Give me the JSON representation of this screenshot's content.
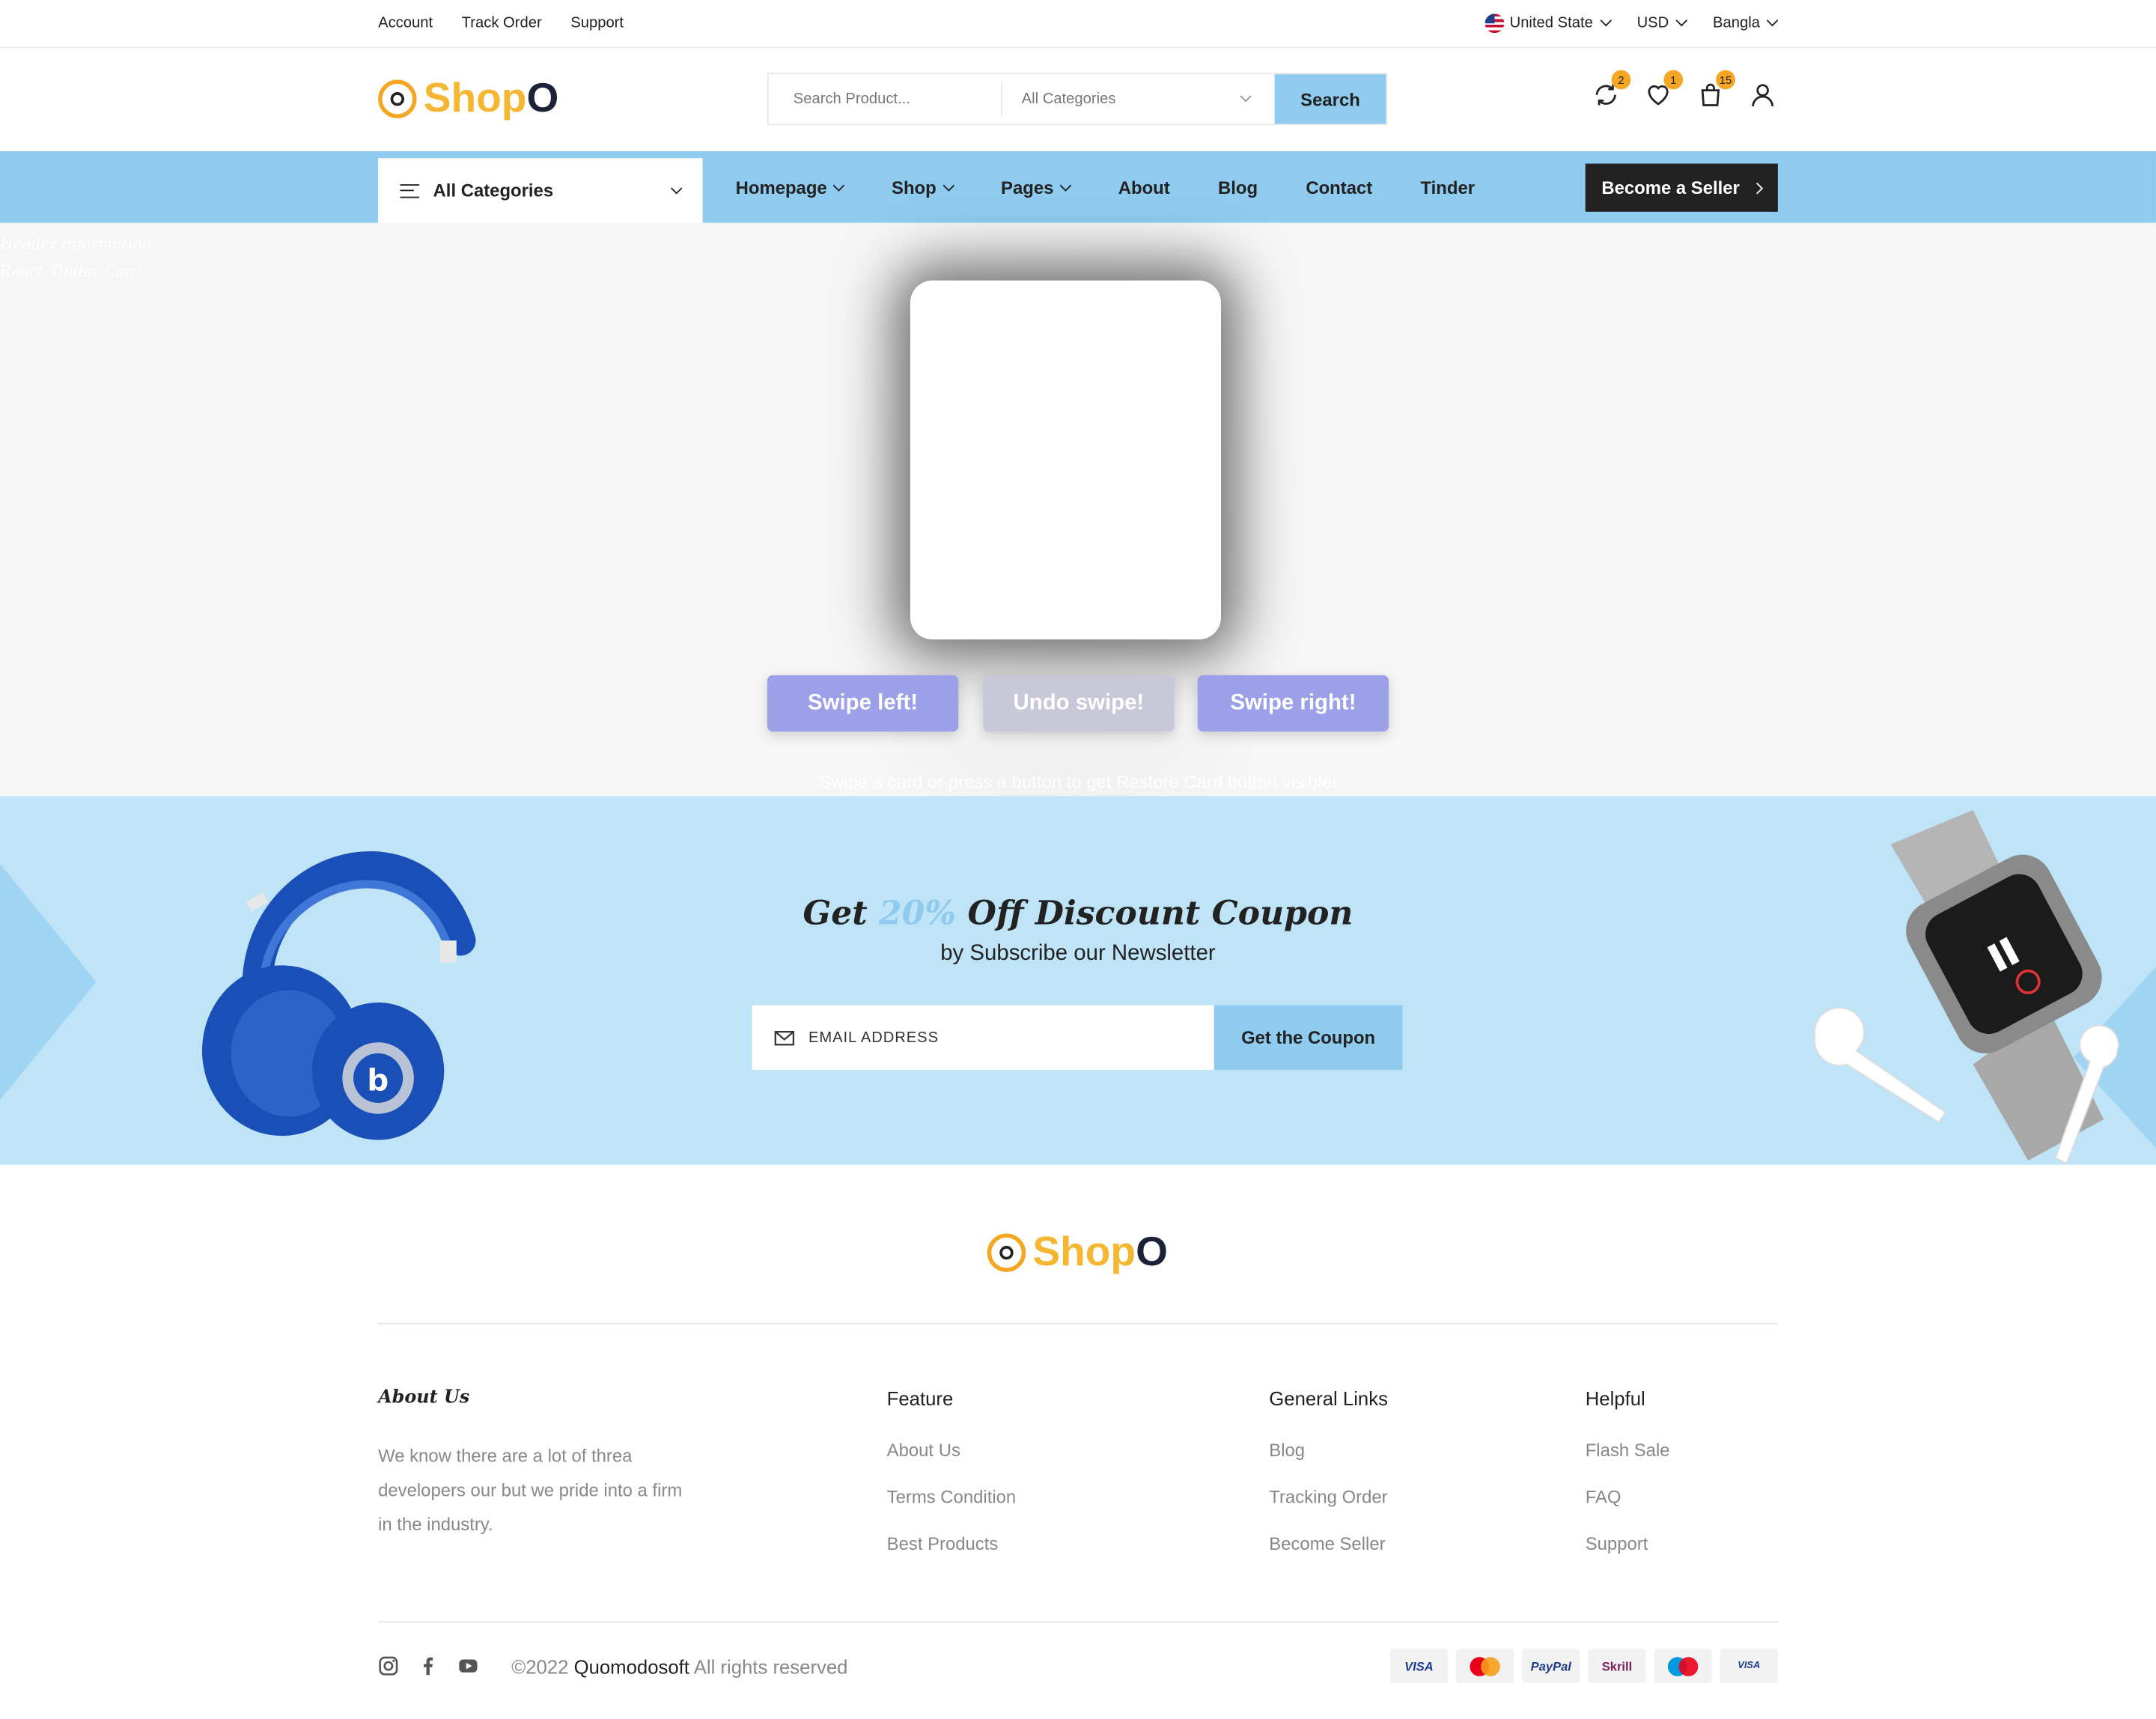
{
  "topbar": {
    "links": [
      "Account",
      "Track Order",
      "Support"
    ],
    "country": "United State",
    "currency": "USD",
    "language": "Bangla"
  },
  "header": {
    "logo_text_1": "Shop",
    "logo_text_2": "O",
    "search_placeholder": "Search Product...",
    "category_select": "All Categories",
    "search_button": "Search",
    "compare_count": "2",
    "wishlist_count": "1",
    "cart_count": "15"
  },
  "nav": {
    "all_categories": "All Categories",
    "items": [
      {
        "label": "Homepage",
        "dropdown": true
      },
      {
        "label": "Shop",
        "dropdown": true
      },
      {
        "label": "Pages",
        "dropdown": true
      },
      {
        "label": "About",
        "dropdown": false
      },
      {
        "label": "Blog",
        "dropdown": false
      },
      {
        "label": "Contact",
        "dropdown": false
      },
      {
        "label": "Tinder",
        "dropdown": false
      }
    ],
    "seller_button": "Become a Seller"
  },
  "tinder": {
    "ghost_line_1": "Header information",
    "ghost_line_2": "React Tinder Card",
    "swipe_left": "Swipe left!",
    "undo": "Undo swipe!",
    "swipe_right": "Swipe right!",
    "hint": "Swipe a card or press a button to get Restore Card button visible!"
  },
  "newsletter": {
    "title_prefix": "Get",
    "title_percent": "20%",
    "title_suffix": "Off Discount Coupon",
    "subtitle": "by Subscribe our Newsletter",
    "email_placeholder": "EMAIL ADDRESS",
    "button": "Get the Coupon"
  },
  "footer": {
    "about_title": "About Us",
    "about_text": "We know there are a lot of threa developers our but we pride into a firm in the industry.",
    "feature_title": "Feature",
    "feature_items": [
      "About Us",
      "Terms Condition",
      "Best Products"
    ],
    "general_title": "General Links",
    "general_items": [
      "Blog",
      "Tracking Order",
      "Become Seller"
    ],
    "helpful_title": "Helpful",
    "helpful_items": [
      "Flash Sale",
      "FAQ",
      "Support"
    ],
    "copyright_prefix": "©2022",
    "copyright_company": "Quomodosoft",
    "copyright_suffix": "All rights reserved",
    "payments": [
      "VISA",
      "MasterCard",
      "PayPal",
      "Skrill",
      "Maestro",
      "VISA Electron"
    ]
  },
  "colors": {
    "accent": "#8ecbee",
    "logo_orange": "#f5b731",
    "newsletter_bg": "#bfe4f8",
    "swipe_button": "#9ca0e8"
  }
}
